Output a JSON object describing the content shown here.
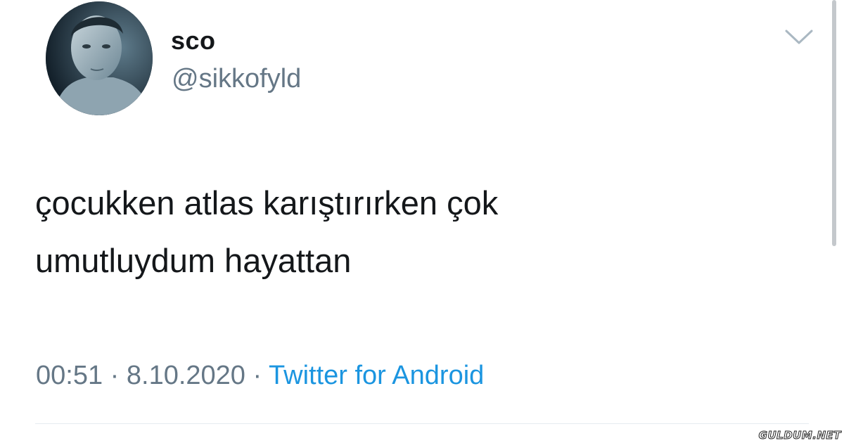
{
  "tweet": {
    "display_name": "sco",
    "handle": "@sikkofyld",
    "text_lines": [
      "çocukken atlas karıştırırken çok",
      "umutluydum hayattan"
    ],
    "time": "00:51",
    "separator": " · ",
    "date": "8.10.2020",
    "source": "Twitter for Android",
    "menu_icon": "chevron-down-icon"
  },
  "watermark": "GULDUM.NET",
  "colors": {
    "text": "#14171a",
    "secondary": "#657786",
    "link": "#1b95e0",
    "divider": "#e6ecf0"
  }
}
